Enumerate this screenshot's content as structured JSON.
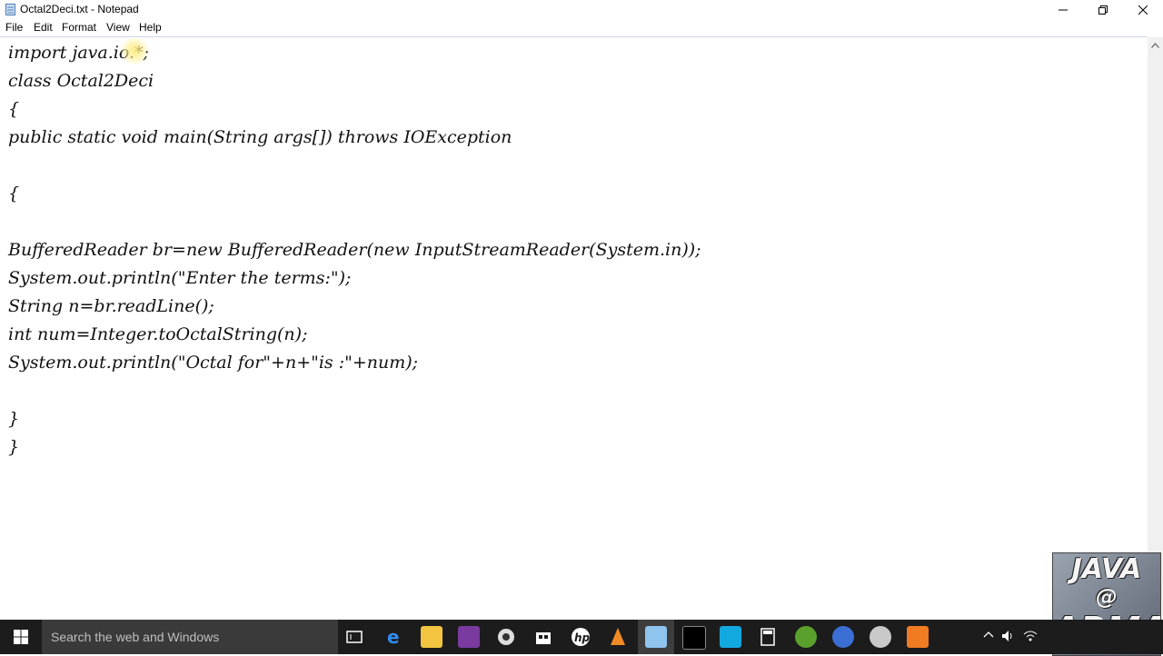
{
  "window": {
    "title": "Octal2Deci.txt - Notepad"
  },
  "menu": {
    "items": [
      "File",
      "Edit",
      "Format",
      "View",
      "Help"
    ]
  },
  "editor": {
    "lines": [
      "import java.io.*;",
      "class Octal2Deci",
      "{",
      "public static void main(String args[]) throws IOException",
      "",
      "{",
      "",
      "BufferedReader br=new BufferedReader(new InputStreamReader(System.in));",
      "System.out.println(\"Enter the terms:\");",
      "String n=br.readLine();",
      "int num=Integer.toOctalString(n);",
      "System.out.println(\"Octal for\"+n+\"is :\"+num);",
      "",
      "}",
      "}"
    ]
  },
  "taskbar": {
    "search_placeholder": "Search the web and Windows",
    "icons": [
      "task-view-icon",
      "edge-icon",
      "file-explorer-icon",
      "app-icon",
      "chrome-icon",
      "store-icon",
      "hp-icon",
      "vlc-icon",
      "notepad-icon",
      "cmd-icon",
      "app-blue-icon",
      "calculator-icon",
      "utorrent-icon",
      "browser-icon",
      "app-gray-icon",
      "app-orange-icon"
    ]
  },
  "watermark": {
    "line1": "JAVA",
    "line2": "@",
    "line3": "ARMA"
  },
  "colors": {
    "taskbar": "#1c1c1c",
    "search_box": "#3a3a3a",
    "editor_bg": "#ffffff"
  }
}
